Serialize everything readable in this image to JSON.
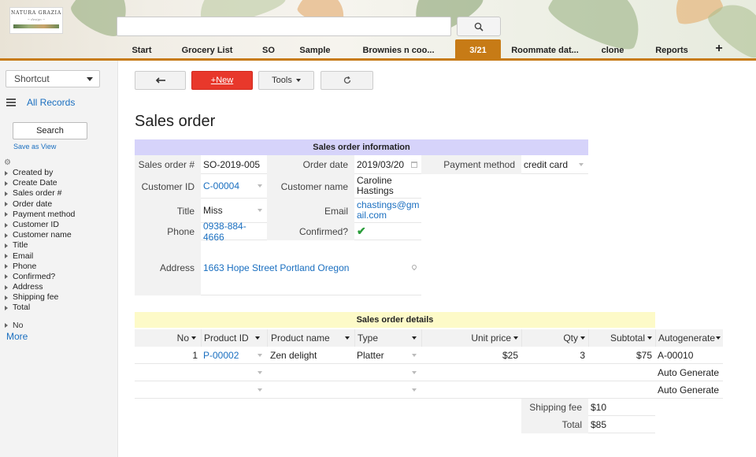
{
  "header": {
    "logo_text": "NATURA GRAZIA",
    "logo_sub": "~ design ~",
    "search_value": "",
    "search_placeholder": "",
    "tabs": [
      {
        "label": "Start",
        "active": false
      },
      {
        "label": "Grocery List",
        "active": false
      },
      {
        "label": "SO",
        "active": false
      },
      {
        "label": "Sample",
        "active": false
      },
      {
        "label": "Brownies n coo...",
        "active": false
      },
      {
        "label": "3/21",
        "active": true
      },
      {
        "label": "Roommate dat...",
        "active": false
      },
      {
        "label": "clone",
        "active": false
      },
      {
        "label": "Reports",
        "active": false
      }
    ],
    "add_tab_label": "+",
    "accent_color": "#c77b16"
  },
  "sidebar": {
    "shortcut_label": "Shortcut",
    "all_records_label": "All Records",
    "search_label": "Search",
    "save_view_label": "Save as View",
    "fields": [
      "Created by",
      "Create Date",
      "Sales order #",
      "Order date",
      "Payment method",
      "Customer ID",
      "Customer name",
      "Title",
      "Email",
      "Phone",
      "Confirmed?",
      "Address",
      "Shipping fee",
      "Total"
    ],
    "no_label": "No",
    "more_label": "More"
  },
  "toolbar": {
    "back_icon": "arrow-left-icon",
    "new_label": "+New",
    "tools_label": "Tools",
    "refresh_icon": "refresh-icon"
  },
  "page": {
    "title": "Sales order"
  },
  "info": {
    "section_title": "Sales order information",
    "sales_order_no": {
      "label": "Sales order #",
      "value": "SO-2019-005"
    },
    "order_date": {
      "label": "Order date",
      "value": "2019/03/20"
    },
    "payment_method": {
      "label": "Payment method",
      "value": "credit card"
    },
    "customer_id": {
      "label": "Customer ID",
      "value": "C-00004"
    },
    "customer_name": {
      "label": "Customer name",
      "value_line1": "Caroline",
      "value_line2": "Hastings"
    },
    "title": {
      "label": "Title",
      "value": "Miss"
    },
    "email": {
      "label": "Email",
      "value_line1": "chastings@gm",
      "value_line2": "ail.com"
    },
    "phone": {
      "label": "Phone",
      "value": "0938-884-4666"
    },
    "confirmed": {
      "label": "Confirmed?",
      "value": "✔"
    },
    "address": {
      "label": "Address",
      "value": "1663 Hope Street Portland Oregon"
    }
  },
  "details": {
    "section_title": "Sales order details",
    "columns": [
      "No",
      "Product ID",
      "Product name",
      "Type",
      "Unit price",
      "Qty",
      "Subtotal",
      "Autogenerate"
    ],
    "rows": [
      {
        "no": "1",
        "product_id": "P-00002",
        "product_name": "Zen delight",
        "type": "Platter",
        "unit_price": "$25",
        "qty": "3",
        "subtotal": "$75",
        "autogenerate": "A-00010"
      },
      {
        "no": "",
        "product_id": "",
        "product_name": "",
        "type": "",
        "unit_price": "",
        "qty": "",
        "subtotal": "",
        "autogenerate": "Auto Generate"
      },
      {
        "no": "",
        "product_id": "",
        "product_name": "",
        "type": "",
        "unit_price": "",
        "qty": "",
        "subtotal": "",
        "autogenerate": "Auto Generate"
      }
    ],
    "shipping_fee": {
      "label": "Shipping fee",
      "value": "$10"
    },
    "total": {
      "label": "Total",
      "value": "$85"
    }
  }
}
